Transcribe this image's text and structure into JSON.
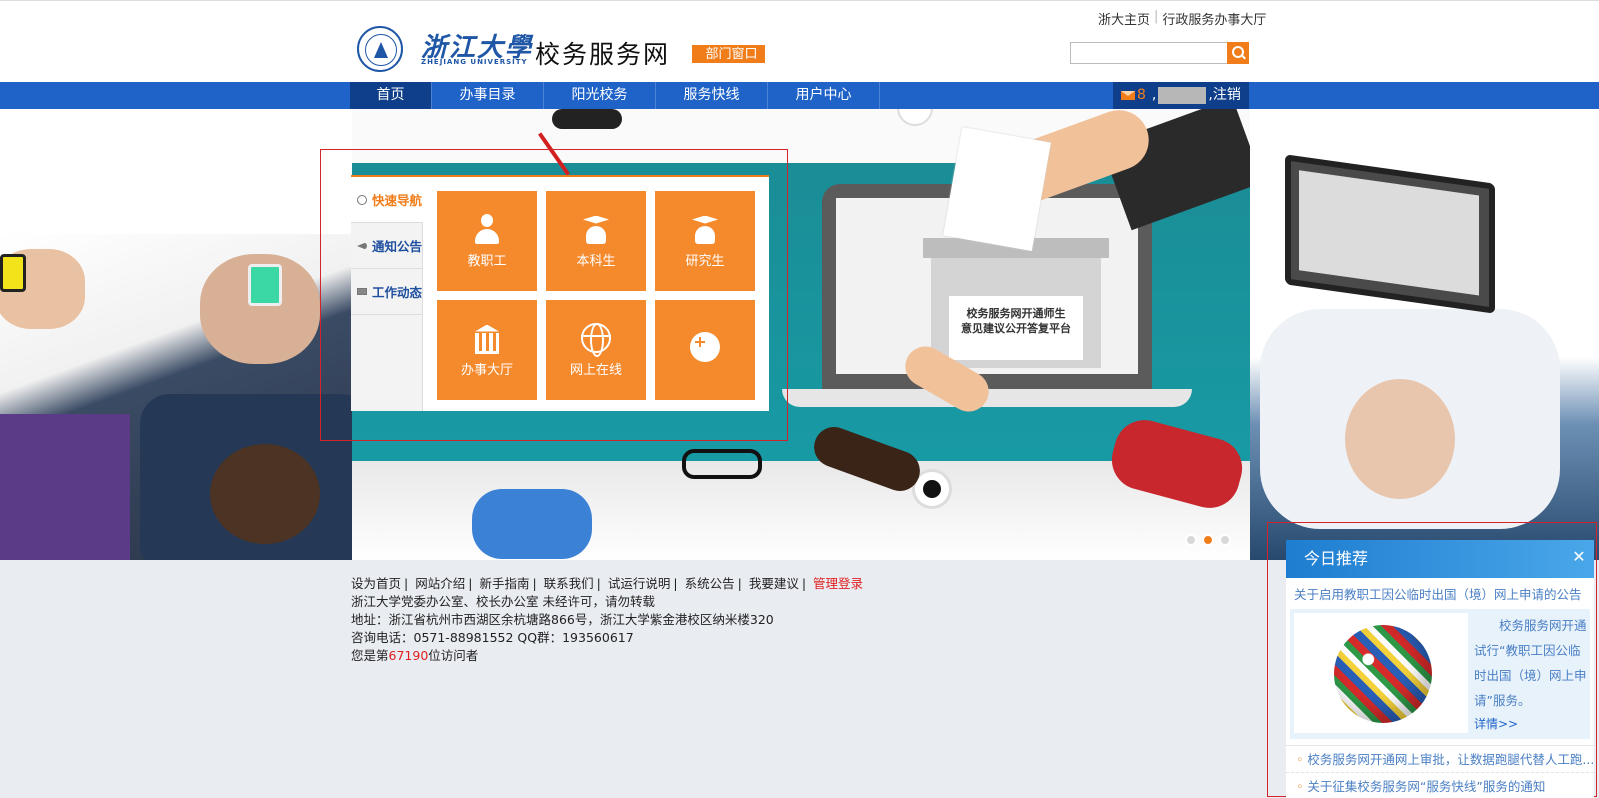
{
  "header": {
    "logo_cn": "浙江大學",
    "logo_en": "ZHEJIANG UNIVERSITY",
    "site_title": "校务服务网",
    "dept_button": "部门窗口",
    "top_links": [
      "浙大主页",
      "行政服务办事大厅"
    ],
    "search": {
      "placeholder": "",
      "value": ""
    }
  },
  "nav": {
    "items": [
      "首页",
      "办事目录",
      "阳光校务",
      "服务快线",
      "用户中心"
    ],
    "active_index": 0,
    "mail_count": "8",
    "separator": ",",
    "logout": ",注销"
  },
  "banner": {
    "ballot_text_line1": "校务服务网开通师生",
    "ballot_text_line2": "意见建议公开答复平台",
    "slides": 3,
    "active_slide": 1
  },
  "quick_nav": {
    "tabs": [
      "快速导航",
      "通知公告",
      "工作动态"
    ],
    "active_tab": 0,
    "tiles": [
      {
        "label": "教职工",
        "icon": "staff-icon"
      },
      {
        "label": "本科生",
        "icon": "undergrad-icon"
      },
      {
        "label": "研究生",
        "icon": "graduate-icon"
      },
      {
        "label": "办事大厅",
        "icon": "hall-icon"
      },
      {
        "label": "网上在线",
        "icon": "online-icon"
      },
      {
        "label": "",
        "icon": "plus-icon"
      }
    ]
  },
  "footer": {
    "links": [
      "设为首页",
      "网站介绍",
      "新手指南",
      "联系我们",
      "试运行说明",
      "系统公告",
      "我要建议"
    ],
    "admin_login": "管理登录",
    "line2": "浙江大学党委办公室、校长办公室   未经许可，请勿转载",
    "line3": "地址：浙江省杭州市西湖区余杭塘路866号，浙江大学紫金港校区纳米楼320",
    "line4": "咨询电话：0571-88981552 QQ群：193560617",
    "visitor_prefix": "您是第",
    "visitor_count": "67190",
    "visitor_suffix": "位访问者"
  },
  "recommend": {
    "title": "今日推荐",
    "close": "✕",
    "headline": "关于启用教职工因公临时出国（境）网上申请的公告",
    "summary": "校务服务网开通试行“教职工因公临时出国（境）网上申请”服务。",
    "more": "详情>>",
    "list": [
      "校务服务网开通网上审批，让数据跑腿代替人工跑...",
      "关于征集校务服务网“服务快线”服务的通知"
    ]
  },
  "colors": {
    "brand_blue": "#1f63c8",
    "accent_orange": "#f07d1a",
    "annotation_red": "#d3232b"
  }
}
